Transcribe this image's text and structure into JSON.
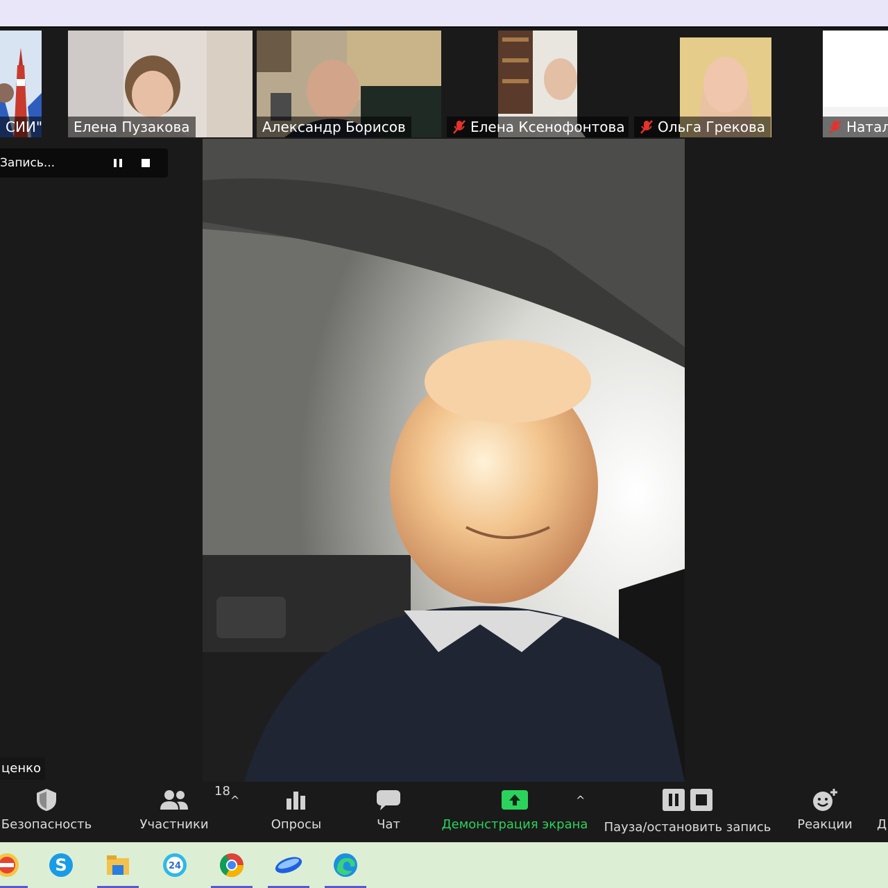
{
  "gallery": {
    "tiles": [
      {
        "name": "СИИ\" Р...",
        "muted": false
      },
      {
        "name": "Елена Пузакова",
        "muted": false
      },
      {
        "name": "Александр Борисов",
        "muted": false
      },
      {
        "name": "Елена Ксенофонтова",
        "muted": true
      },
      {
        "name": "Ольга Грекова",
        "muted": true
      },
      {
        "name": "Натал",
        "muted": true
      }
    ]
  },
  "recording": {
    "status_text": "Запись...",
    "pause_icon": "pause-icon",
    "stop_icon": "stop-icon"
  },
  "speaker_label": "ценко",
  "toolbar": {
    "security_label": "Безопасность",
    "participants_label": "Участники",
    "participants_count": "18",
    "polls_label": "Опросы",
    "chat_label": "Чат",
    "share_label": "Демонстрация экрана",
    "record_label": "Пауза/остановить запись",
    "reactions_label": "Реакции",
    "more_label": "Д",
    "caret": "^",
    "accent_green": "#2bd35c"
  },
  "taskbar": {
    "apps": [
      "yandex-browser-icon",
      "skype-icon",
      "file-explorer-icon",
      "bitrix24-icon",
      "chrome-icon",
      "zoom-icon",
      "edge-icon"
    ],
    "bitrix_badge": "24",
    "underline_color": "#5c58c7"
  }
}
